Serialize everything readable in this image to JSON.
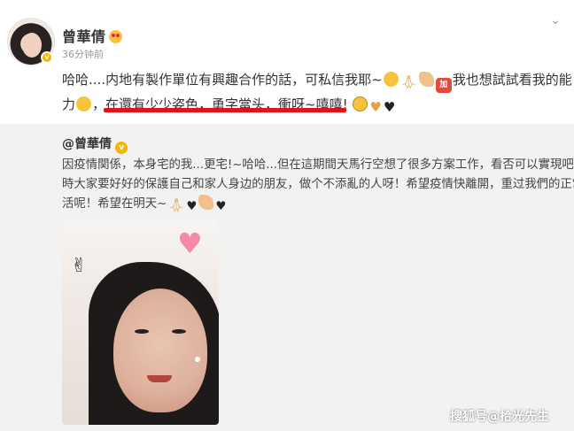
{
  "post": {
    "author": "曾華倩",
    "time": "36分钟前",
    "line1_text": "哈哈....内地有製作單位有興趣合作的話，可私信我耶~",
    "line1_tail": "我也想試試看我的能",
    "line2_head": "力",
    "highlight": "在還有少少姿色，勇字當头，衝呀~嘻嘻!",
    "jia_label": "加"
  },
  "repost": {
    "author": "@曾華倩",
    "lines": [
      "因疫情関係，本身宅的我...更宅!~哈哈...但在這期間天馬行空想了很多方案工作，看否可以實現吧！同",
      "時大家要好好的保護自己和家人身边的朋友，做个不添亂的人呀！希望疫情快離開，重过我們的正常生",
      "活呢！希望在明天~"
    ]
  },
  "watermark": "搜狐号@拾光先生",
  "colors": {
    "accent_underline": "#e1121a",
    "verified_badge": "#f7b500",
    "repost_bg": "#f2f2f2"
  },
  "icons": {
    "menu": "chevron-down-icon",
    "verified": "verified-badge-icon"
  }
}
